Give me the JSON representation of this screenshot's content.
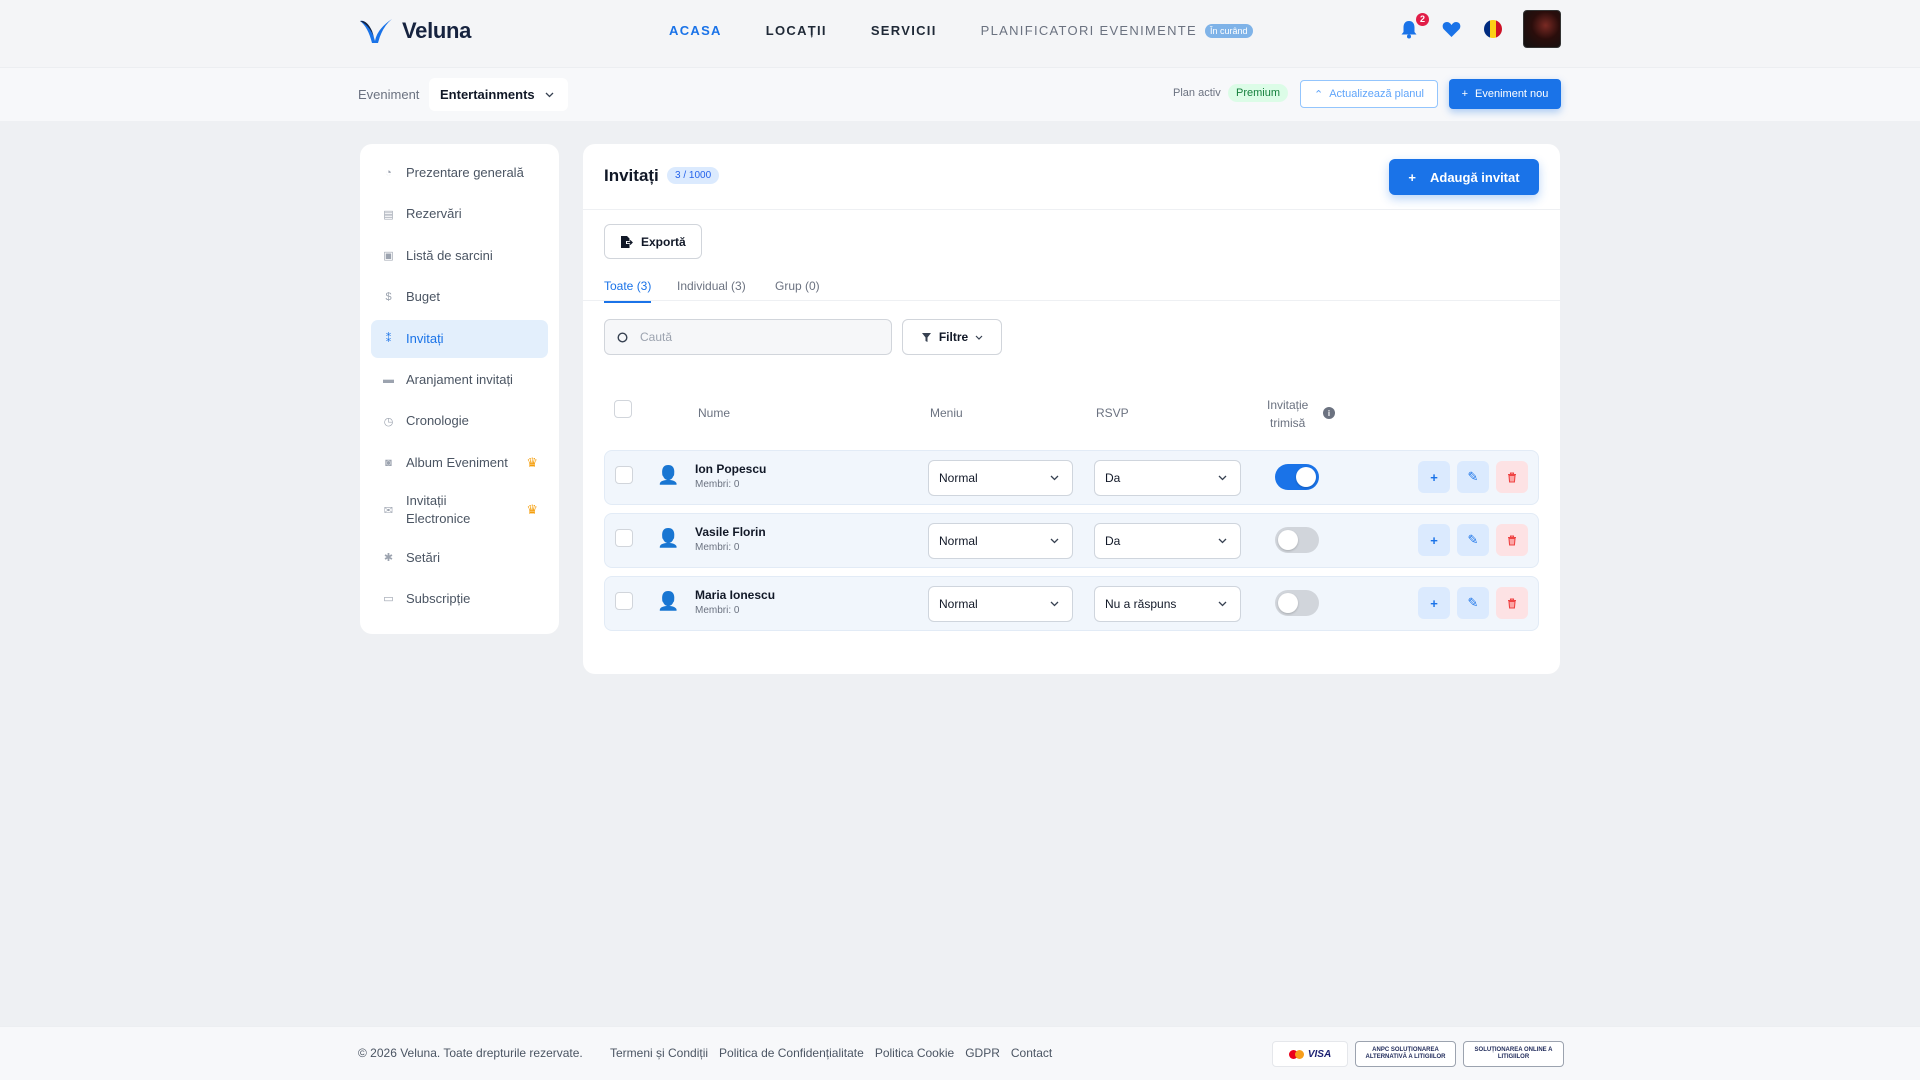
{
  "brand": {
    "name": "Veluna",
    "color": "#1a73e8"
  },
  "nav": {
    "links": [
      {
        "label": "ACASA",
        "active": true
      },
      {
        "label": "LOCAȚII",
        "active": false
      },
      {
        "label": "SERVICII",
        "active": false
      }
    ],
    "planners": {
      "label": "PLANIFICATORI EVENIMENTE",
      "badge": "În curând"
    },
    "notifications_count": "2"
  },
  "subbar": {
    "event_label": "Eveniment",
    "event_selected": "Entertainments",
    "plan_label": "Plan activ",
    "plan_name": "Premium",
    "upgrade_label": "Actualizează planul",
    "new_event_label": "Eveniment nou"
  },
  "sidebar": {
    "items": [
      {
        "label": "Prezentare generală",
        "icon": "chart-pie-icon"
      },
      {
        "label": "Rezervări",
        "icon": "building-icon"
      },
      {
        "label": "Listă de sarcini",
        "icon": "clipboard-icon"
      },
      {
        "label": "Buget",
        "icon": "dollar-icon"
      },
      {
        "label": "Invitați",
        "icon": "people-icon",
        "active": true
      },
      {
        "label": "Aranjament invitați",
        "icon": "table-icon"
      },
      {
        "label": "Cronologie",
        "icon": "clock-icon"
      },
      {
        "label": "Album Eveniment",
        "icon": "camera-icon",
        "premium": true
      },
      {
        "label": "Invitații Electronice",
        "icon": "envelope-icon",
        "premium": true
      },
      {
        "label": "Setări",
        "icon": "gear-icon"
      },
      {
        "label": "Subscripție",
        "icon": "card-icon"
      }
    ]
  },
  "main": {
    "title": "Invitați",
    "count": "3 / 1000",
    "add_label": "Adaugă invitat",
    "export_label": "Exportă",
    "tabs": [
      {
        "label": "Toate (3)",
        "active": true
      },
      {
        "label": "Individual (3)",
        "active": false
      },
      {
        "label": "Grup (0)",
        "active": false
      }
    ],
    "search_placeholder": "Caută",
    "filters_label": "Filtre",
    "columns": {
      "name": "Nume",
      "menu": "Meniu",
      "rsvp": "RSVP",
      "invite_sent_line1": "Invitație",
      "invite_sent_line2": "trimisă"
    },
    "guests": [
      {
        "name": "Ion Popescu",
        "members": "Membri: 0",
        "menu": "Normal",
        "rsvp": "Da",
        "invite_sent": true
      },
      {
        "name": "Vasile Florin",
        "members": "Membri: 0",
        "menu": "Normal",
        "rsvp": "Da",
        "invite_sent": false
      },
      {
        "name": "Maria Ionescu",
        "members": "Membri: 0",
        "menu": "Normal",
        "rsvp": "Nu a răspuns",
        "invite_sent": false
      }
    ]
  },
  "footer": {
    "copyright": "© 2026 Veluna. Toate drepturile rezervate.",
    "links": [
      "Termeni și Condiții",
      "Politica de Confidențialitate",
      "Politica Cookie",
      "GDPR",
      "Contact"
    ],
    "badges": [
      "VISA",
      "ANPC SOLUȚIONAREA ALTERNATIVĂ A LITIGIILOR",
      "SOLUȚIONAREA ONLINE A LITIGIILOR"
    ]
  }
}
